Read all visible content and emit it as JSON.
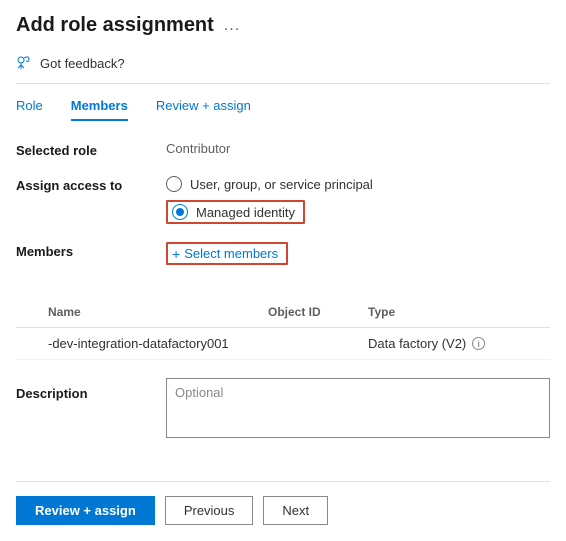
{
  "header": {
    "title": "Add role assignment",
    "more": "..."
  },
  "feedback_label": "Got feedback?",
  "tabs": {
    "role": "Role",
    "members": "Members",
    "review": "Review + assign"
  },
  "labels": {
    "selected_role": "Selected role",
    "assign_access": "Assign access to",
    "members": "Members",
    "description": "Description"
  },
  "selected_role_value": "Contributor",
  "assign_options": {
    "option1": "User, group, or service principal",
    "option2": "Managed identity",
    "selected": "option2"
  },
  "select_members_label": "Select members",
  "members_table": {
    "columns": {
      "name": "Name",
      "object_id": "Object ID",
      "type": "Type"
    },
    "rows": [
      {
        "name": "-dev-integration-datafactory001",
        "object_id": "",
        "type": "Data factory (V2)"
      }
    ]
  },
  "description_placeholder": "Optional",
  "footer": {
    "primary": "Review + assign",
    "previous": "Previous",
    "next": "Next"
  }
}
